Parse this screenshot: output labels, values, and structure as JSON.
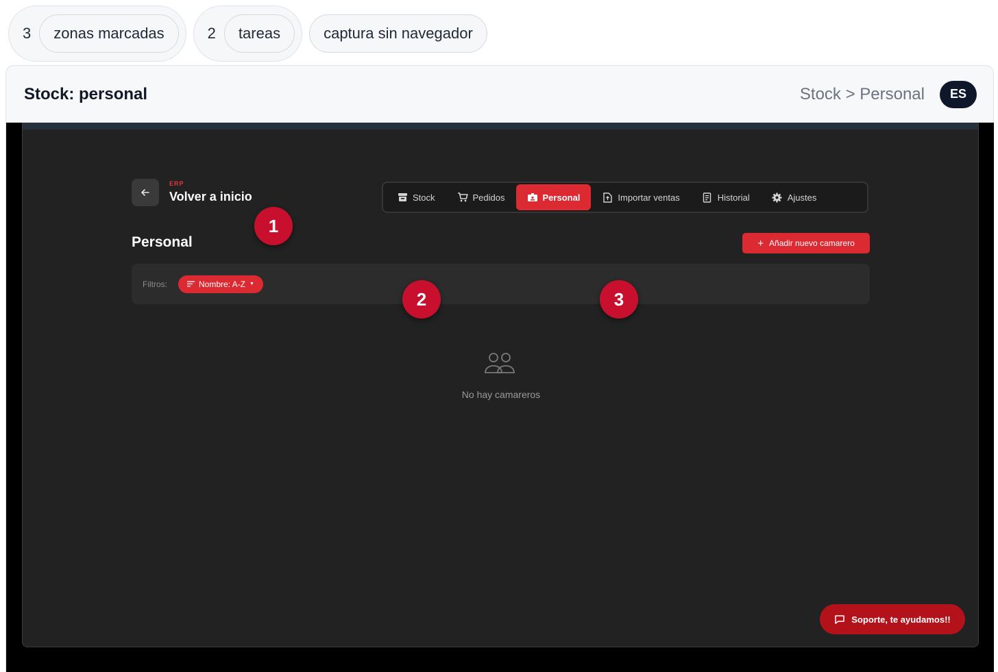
{
  "stats": [
    {
      "count": "3",
      "label": "zonas marcadas"
    },
    {
      "count": "2",
      "label": "tareas"
    }
  ],
  "capture_label": "captura sin navegador",
  "window": {
    "title": "Stock: personal",
    "breadcrumb": "Stock > Personal",
    "language": "ES"
  },
  "app": {
    "brand": "ERP",
    "home_link": "Volver a inicio",
    "nav": [
      {
        "label": "Stock",
        "icon": "archive-icon"
      },
      {
        "label": "Pedidos",
        "icon": "cart-icon"
      },
      {
        "label": "Personal",
        "icon": "badge-icon",
        "active": true
      },
      {
        "label": "Importar ventas",
        "icon": "file-import-icon"
      },
      {
        "label": "Historial",
        "icon": "receipt-icon"
      },
      {
        "label": "Ajustes",
        "icon": "gear-icon"
      }
    ],
    "page_title": "Personal",
    "add_button": "Añadir nuevo camarero",
    "filters_label": "Filtros:",
    "sort_filter": "Nombre: A-Z",
    "empty_message": "No hay camareros",
    "support_button": "Soporte, te ayudamos!!"
  },
  "markers": [
    "1",
    "2",
    "3"
  ],
  "colors": {
    "accent": "#dc2a33",
    "marker": "#c8102e",
    "app_bg": "#222222"
  }
}
